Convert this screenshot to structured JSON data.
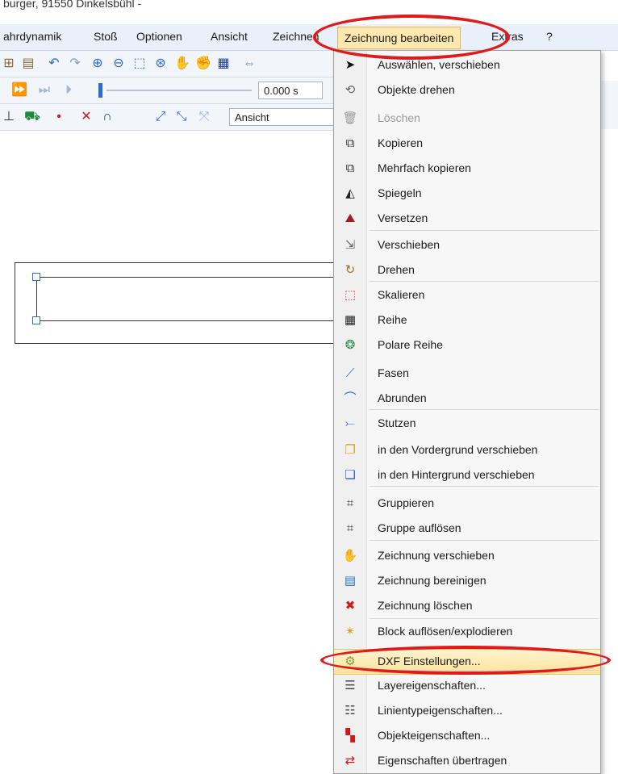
{
  "title_bar": {
    "text": "burger, 91550 Dinkelsbühl -"
  },
  "menubar": {
    "items": [
      "ahrdynamik",
      "Stoß",
      "Optionen",
      "Ansicht",
      "Zeichnen",
      "Zeichnung bearbeiten",
      "Extras",
      "?"
    ]
  },
  "toolbar2": {
    "time_value": "0.000 s"
  },
  "toolbar3": {
    "view_value": "Ansicht"
  },
  "dropdown": {
    "items": [
      {
        "label": "Auswählen, verschieben",
        "icon": "cursor-arrow-icon",
        "glyph": "➤"
      },
      {
        "label": "Objekte drehen",
        "icon": "rotate-objects-icon",
        "glyph": "⟲"
      },
      {
        "label": "Löschen",
        "icon": "delete-icon",
        "glyph": "🗑",
        "disabled": true
      },
      {
        "label": "Kopieren",
        "icon": "copy-icon",
        "glyph": "⧉"
      },
      {
        "label": "Mehrfach kopieren",
        "icon": "multi-copy-icon",
        "glyph": "⧉"
      },
      {
        "label": "Spiegeln",
        "icon": "mirror-icon",
        "glyph": "◭"
      },
      {
        "label": "Versetzen",
        "icon": "offset-icon",
        "glyph": "⛰"
      },
      {
        "label": "Verschieben",
        "icon": "move-icon",
        "glyph": "⇲"
      },
      {
        "label": "Drehen",
        "icon": "rotate-icon",
        "glyph": "↻"
      },
      {
        "label": "Skalieren",
        "icon": "scale-icon",
        "glyph": "⬚"
      },
      {
        "label": "Reihe",
        "icon": "array-icon",
        "glyph": "▦"
      },
      {
        "label": "Polare Reihe",
        "icon": "polar-array-icon",
        "glyph": "❂"
      },
      {
        "label": "Fasen",
        "icon": "chamfer-icon",
        "glyph": "⟋"
      },
      {
        "label": "Abrunden",
        "icon": "fillet-icon",
        "glyph": "⌒"
      },
      {
        "label": "Stutzen",
        "icon": "trim-icon",
        "glyph": "⤚"
      },
      {
        "label": "in den Vordergrund verschieben",
        "icon": "bring-to-front-icon",
        "glyph": "❐"
      },
      {
        "label": "in den Hintergrund verschieben",
        "icon": "send-to-back-icon",
        "glyph": "❏"
      },
      {
        "label": "Gruppieren",
        "icon": "group-icon",
        "glyph": "⌗"
      },
      {
        "label": "Gruppe auflösen",
        "icon": "ungroup-icon",
        "glyph": "⌗"
      },
      {
        "label": "Zeichnung verschieben",
        "icon": "pan-hand-icon",
        "glyph": "✋"
      },
      {
        "label": "Zeichnung bereinigen",
        "icon": "clean-drawing-icon",
        "glyph": "▤"
      },
      {
        "label": "Zeichnung löschen",
        "icon": "delete-drawing-icon",
        "glyph": "✖"
      },
      {
        "label": "Block auflösen/explodieren",
        "icon": "explode-block-icon",
        "glyph": "✴"
      },
      {
        "label": "DXF Einstellungen...",
        "icon": "dxf-settings-icon",
        "glyph": "⚙"
      },
      {
        "label": "Layereigenschaften...",
        "icon": "layer-properties-icon",
        "glyph": "☰"
      },
      {
        "label": "Linientypeigenschaften...",
        "icon": "linetype-properties-icon",
        "glyph": "☷"
      },
      {
        "label": "Objekteigenschaften...",
        "icon": "object-properties-icon",
        "glyph": "▚"
      },
      {
        "label": "Eigenschaften übertragen",
        "icon": "transfer-properties-icon",
        "glyph": "⇄"
      }
    ]
  }
}
